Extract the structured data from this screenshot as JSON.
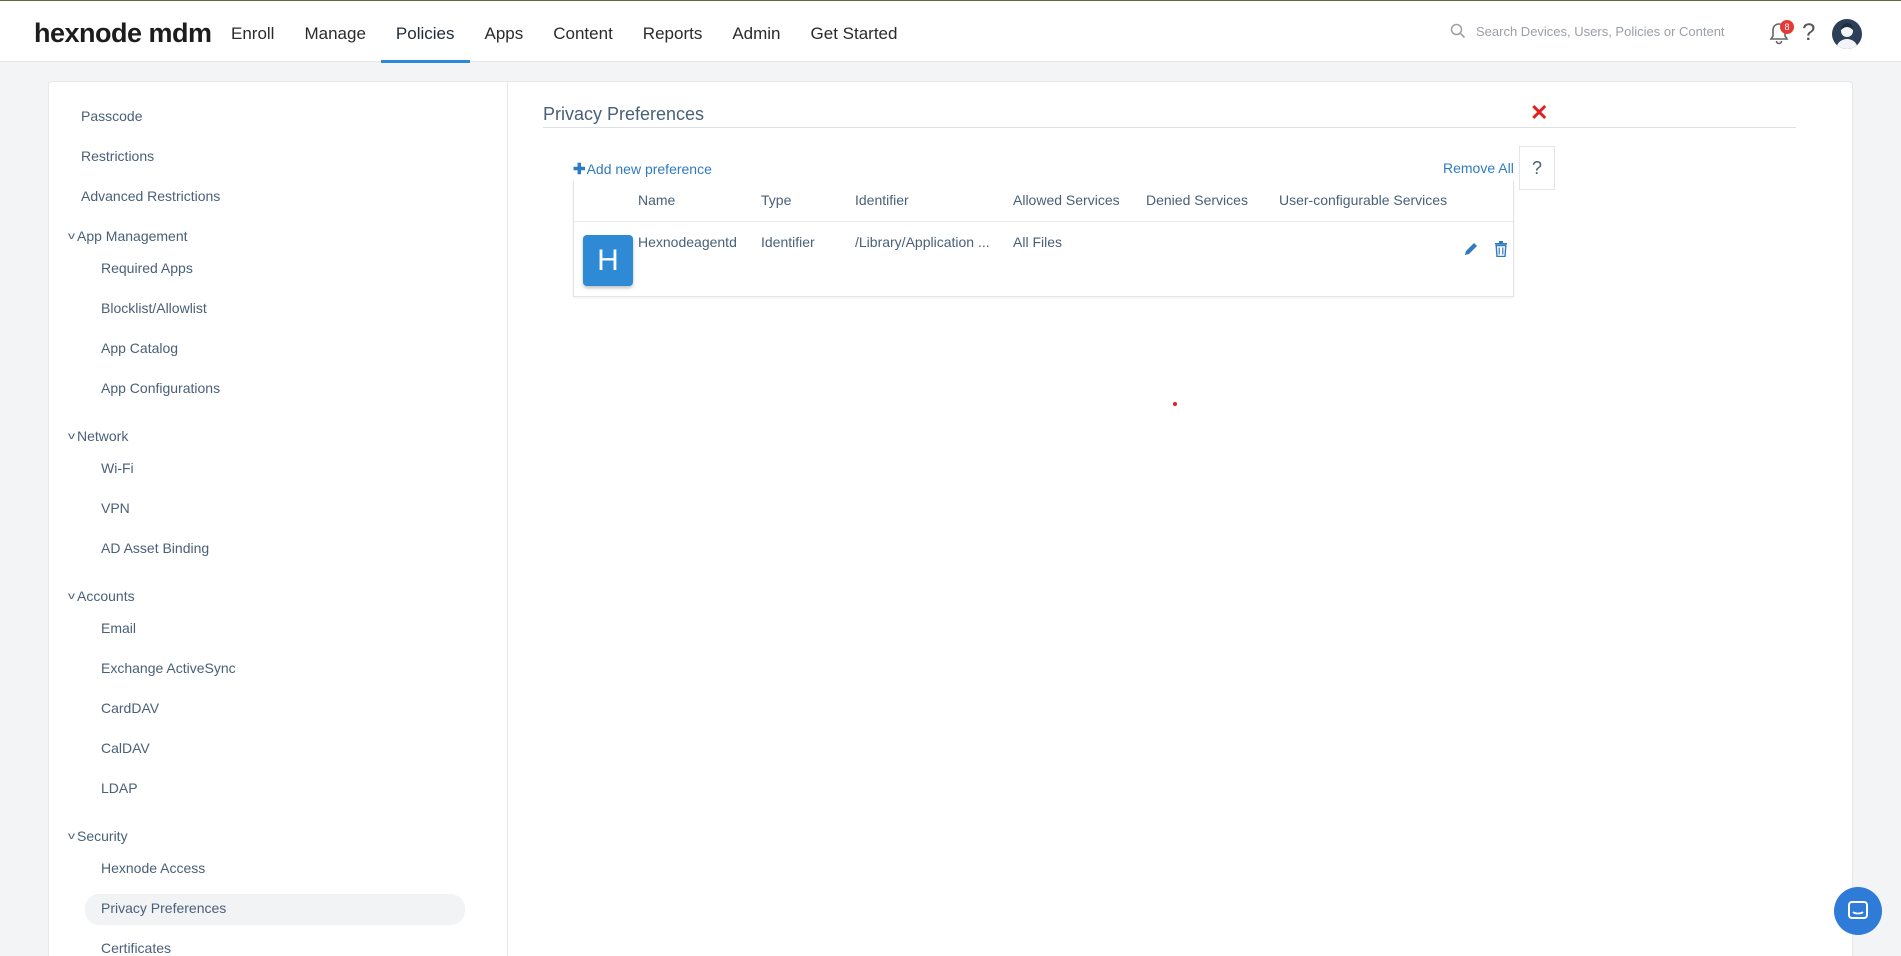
{
  "brand": {
    "logo_text": "hexnode mdm",
    "accent": "#2f8ad6"
  },
  "nav": {
    "items": [
      {
        "label": "Enroll"
      },
      {
        "label": "Manage"
      },
      {
        "label": "Policies",
        "active": true
      },
      {
        "label": "Apps"
      },
      {
        "label": "Content"
      },
      {
        "label": "Reports"
      },
      {
        "label": "Admin"
      },
      {
        "label": "Get Started"
      }
    ]
  },
  "search": {
    "placeholder": "Search Devices, Users, Policies or Content"
  },
  "notifications": {
    "count": "8"
  },
  "sidebar": {
    "passcode": "Passcode",
    "restrictions": "Restrictions",
    "advanced_restrictions": "Advanced Restrictions",
    "app_management": "App Management",
    "required_apps": "Required Apps",
    "blocklist_allowlist": "Blocklist/Allowlist",
    "app_catalog": "App Catalog",
    "app_configurations": "App Configurations",
    "network": "Network",
    "wifi": "Wi-Fi",
    "vpn": "VPN",
    "ad_asset_binding": "AD Asset Binding",
    "accounts": "Accounts",
    "email": "Email",
    "exchange_activesync": "Exchange ActiveSync",
    "carddav": "CardDAV",
    "caldav": "CalDAV",
    "ldap": "LDAP",
    "security": "Security",
    "hexnode_access": "Hexnode Access",
    "privacy_preferences": "Privacy Preferences",
    "certificates": "Certificates"
  },
  "main": {
    "title": "Privacy Preferences",
    "add_label": "Add new preference",
    "remove_all_label": "Remove All",
    "help_label": "?",
    "close_label": "✕",
    "columns": {
      "name": "Name",
      "type": "Type",
      "identifier": "Identifier",
      "allowed": "Allowed Services",
      "denied": "Denied Services",
      "user_configurable": "User-configurable Services"
    },
    "rows": [
      {
        "icon_letter": "H",
        "name": "Hexnodeagentd",
        "type": "Identifier",
        "identifier": "/Library/Application ...",
        "allowed": "All Files",
        "denied": "",
        "user_configurable": ""
      }
    ]
  }
}
